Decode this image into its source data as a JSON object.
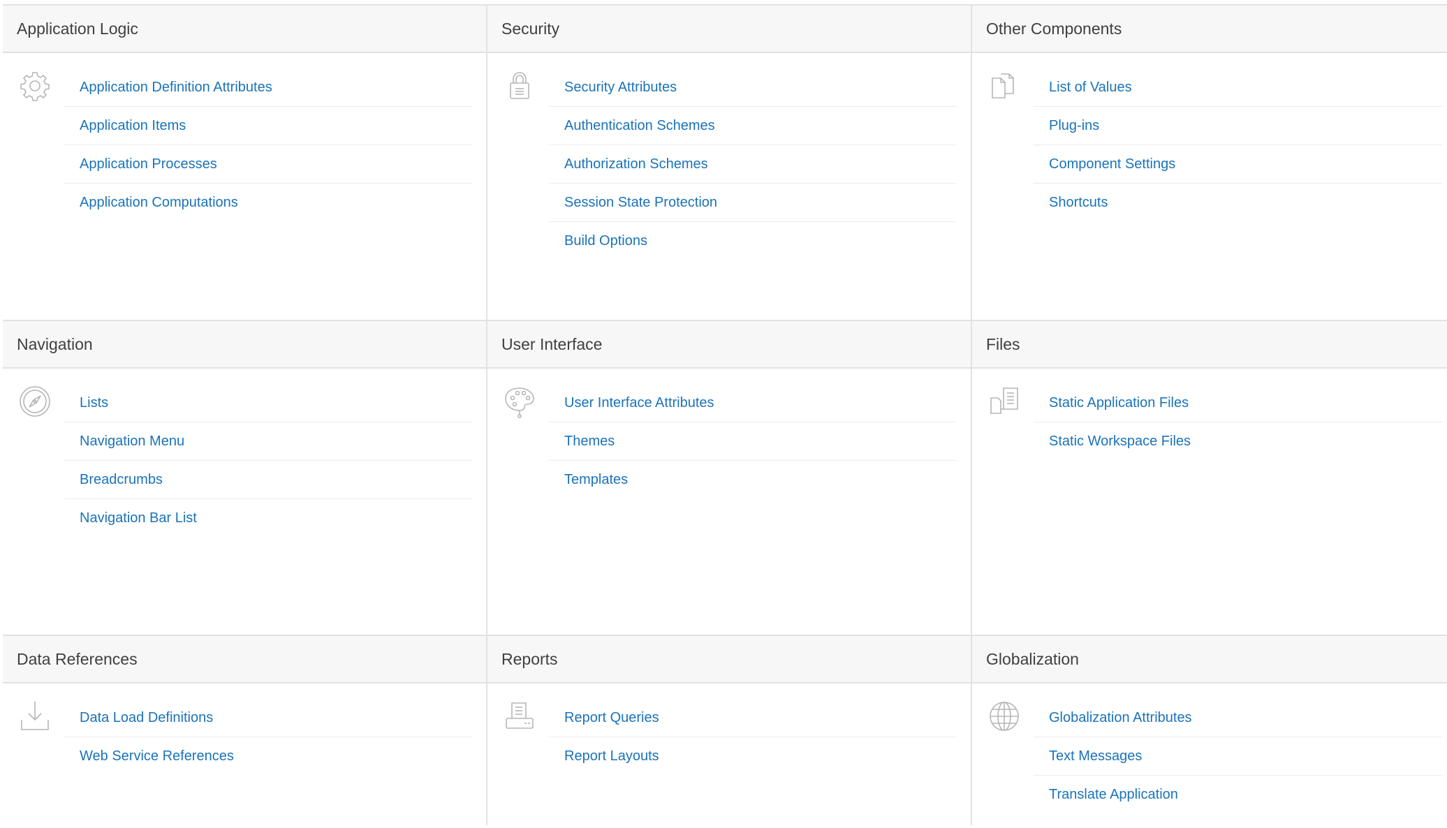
{
  "colors": {
    "link": "#1a73ba",
    "header_bg": "#f7f7f7",
    "border": "#e2e2e2",
    "icon": "#b5b5b5"
  },
  "panels": [
    {
      "title": "Application Logic",
      "icon": "gear-icon",
      "links": [
        "Application Definition Attributes",
        "Application Items",
        "Application Processes",
        "Application Computations"
      ]
    },
    {
      "title": "Security",
      "icon": "lock-icon",
      "links": [
        "Security Attributes",
        "Authentication Schemes",
        "Authorization Schemes",
        "Session State Protection",
        "Build Options"
      ]
    },
    {
      "title": "Other Components",
      "icon": "documents-icon",
      "links": [
        "List of Values",
        "Plug-ins",
        "Component Settings",
        "Shortcuts"
      ]
    },
    {
      "title": "Navigation",
      "icon": "compass-icon",
      "links": [
        "Lists",
        "Navigation Menu",
        "Breadcrumbs",
        "Navigation Bar List"
      ]
    },
    {
      "title": "User Interface",
      "icon": "palette-icon",
      "links": [
        "User Interface Attributes",
        "Themes",
        "Templates"
      ]
    },
    {
      "title": "Files",
      "icon": "files-icon",
      "links": [
        "Static Application Files",
        "Static Workspace Files"
      ]
    },
    {
      "title": "Data References",
      "icon": "download-icon",
      "links": [
        "Data Load Definitions",
        "Web Service References"
      ]
    },
    {
      "title": "Reports",
      "icon": "printer-icon",
      "links": [
        "Report Queries",
        "Report Layouts"
      ]
    },
    {
      "title": "Globalization",
      "icon": "globe-icon",
      "links": [
        "Globalization Attributes",
        "Text Messages",
        "Translate Application"
      ]
    }
  ]
}
